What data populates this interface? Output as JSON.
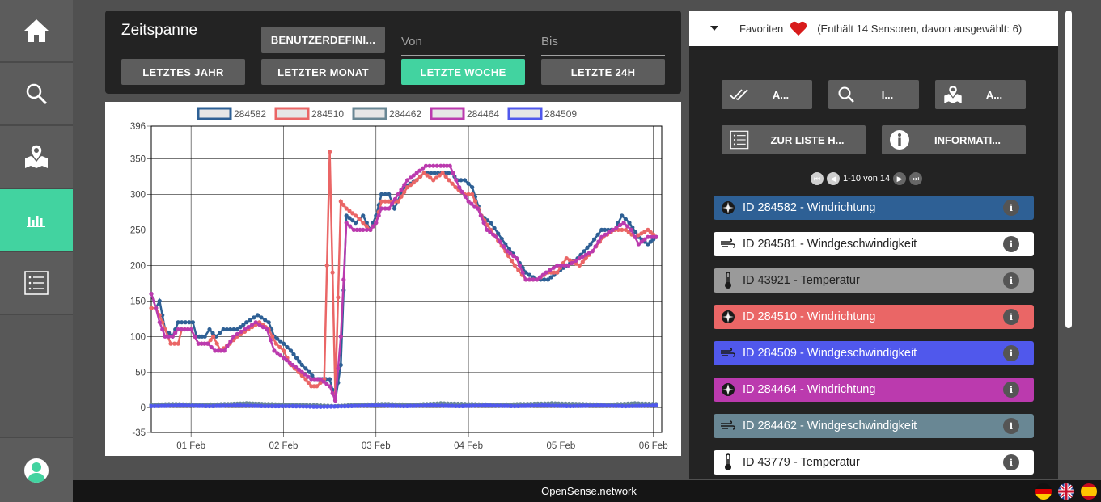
{
  "timespan": {
    "title": "Zeitspanne",
    "custom_label": "BENUTZERDEFINI...",
    "from_label": "Von",
    "to_label": "Bis",
    "buttons": [
      "LETZTES JAHR",
      "LETZTER MONAT",
      "LETZTE WOCHE",
      "LETZTE 24H"
    ],
    "active": "LETZTE WOCHE"
  },
  "favorites": {
    "label": "Favoriten",
    "info": "(Enthält 14 Sensoren, davon ausgewählt: 6)"
  },
  "actions": {
    "a1": "A...",
    "a2": "I...",
    "a3": "A...",
    "list": "ZUR LISTE H...",
    "info": "INFORMATI..."
  },
  "pager": {
    "text": "1-10 von 14"
  },
  "sensors": [
    {
      "label": "ID 284582 - Windrichtung",
      "color": "#2e6095",
      "text_color": "#ffffff",
      "icon": "wind-direction-icon"
    },
    {
      "label": "ID 284581 - Windgeschwindigkeit",
      "color": "#ffffff",
      "text_color": "#222222",
      "icon": "wind-speed-icon"
    },
    {
      "label": "ID 43921 - Temperatur",
      "color": "#9a9a9a",
      "text_color": "#222222",
      "icon": "thermometer-icon"
    },
    {
      "label": "ID 284510 - Windrichtung",
      "color": "#ea6666",
      "text_color": "#ffffff",
      "icon": "wind-direction-icon"
    },
    {
      "label": "ID 284509 - Windgeschwindigkeit",
      "color": "#5058ec",
      "text_color": "#ffffff",
      "icon": "wind-speed-icon"
    },
    {
      "label": "ID 284464 - Windrichtung",
      "color": "#bb3aae",
      "text_color": "#ffffff",
      "icon": "wind-direction-icon"
    },
    {
      "label": "ID 284462 - Windgeschwindigkeit",
      "color": "#698794",
      "text_color": "#ffffff",
      "icon": "wind-speed-icon"
    },
    {
      "label": "ID 43779 - Temperatur",
      "color": "#ffffff",
      "text_color": "#222222",
      "icon": "thermometer-icon"
    }
  ],
  "footer": {
    "brand": "OpenSense.network"
  },
  "chart_data": {
    "type": "line",
    "x_tick_labels": [
      "01 Feb",
      "02 Feb",
      "03 Feb",
      "04 Feb",
      "05 Feb",
      "06 Feb"
    ],
    "y_tick_labels": [
      "-35",
      "0",
      "50",
      "100",
      "150",
      "200",
      "250",
      "300",
      "350",
      "396"
    ],
    "ylim": [
      -35,
      396
    ],
    "xlim": [
      0.57,
      6.09
    ],
    "grid": true,
    "legend_position": "top",
    "series": [
      {
        "name": "284582",
        "color": "#2e6095",
        "points": [
          [
            0.57,
            160
          ],
          [
            0.62,
            140
          ],
          [
            0.66,
            150
          ],
          [
            0.72,
            110
          ],
          [
            0.8,
            100
          ],
          [
            0.86,
            120
          ],
          [
            1.02,
            120
          ],
          [
            1.06,
            100
          ],
          [
            1.15,
            100
          ],
          [
            1.2,
            110
          ],
          [
            1.27,
            100
          ],
          [
            1.35,
            110
          ],
          [
            1.5,
            110
          ],
          [
            1.6,
            120
          ],
          [
            1.72,
            130
          ],
          [
            1.84,
            120
          ],
          [
            1.9,
            100
          ],
          [
            2.0,
            90
          ],
          [
            2.08,
            80
          ],
          [
            2.14,
            70
          ],
          [
            2.2,
            60
          ],
          [
            2.28,
            50
          ],
          [
            2.34,
            40
          ],
          [
            2.5,
            40
          ],
          [
            2.56,
            10
          ],
          [
            2.62,
            60
          ],
          [
            2.68,
            270
          ],
          [
            2.78,
            260
          ],
          [
            2.86,
            270
          ],
          [
            2.94,
            250
          ],
          [
            3.0,
            270
          ],
          [
            3.06,
            300
          ],
          [
            3.14,
            300
          ],
          [
            3.2,
            280
          ],
          [
            3.3,
            310
          ],
          [
            3.44,
            320
          ],
          [
            3.52,
            330
          ],
          [
            3.82,
            330
          ],
          [
            3.88,
            320
          ],
          [
            3.96,
            320
          ],
          [
            4.04,
            310
          ],
          [
            4.14,
            270
          ],
          [
            4.24,
            260
          ],
          [
            4.4,
            230
          ],
          [
            4.52,
            210
          ],
          [
            4.62,
            190
          ],
          [
            4.74,
            180
          ],
          [
            4.86,
            180
          ],
          [
            4.96,
            190
          ],
          [
            5.06,
            200
          ],
          [
            5.18,
            210
          ],
          [
            5.32,
            230
          ],
          [
            5.44,
            250
          ],
          [
            5.58,
            250
          ],
          [
            5.66,
            270
          ],
          [
            5.74,
            260
          ],
          [
            5.84,
            240
          ],
          [
            5.94,
            230
          ],
          [
            6.03,
            240
          ]
        ]
      },
      {
        "name": "284510",
        "color": "#ea6666",
        "points": [
          [
            0.57,
            140
          ],
          [
            0.62,
            140
          ],
          [
            0.66,
            130
          ],
          [
            0.72,
            110
          ],
          [
            0.78,
            90
          ],
          [
            0.86,
            90
          ],
          [
            0.9,
            110
          ],
          [
            1.0,
            110
          ],
          [
            1.08,
            90
          ],
          [
            1.18,
            90
          ],
          [
            1.24,
            100
          ],
          [
            1.32,
            80
          ],
          [
            1.42,
            90
          ],
          [
            1.5,
            100
          ],
          [
            1.62,
            110
          ],
          [
            1.74,
            120
          ],
          [
            1.84,
            110
          ],
          [
            1.92,
            90
          ],
          [
            2.0,
            80
          ],
          [
            2.08,
            60
          ],
          [
            2.16,
            50
          ],
          [
            2.24,
            40
          ],
          [
            2.3,
            30
          ],
          [
            2.36,
            30
          ],
          [
            2.44,
            40
          ],
          [
            2.5,
            360
          ],
          [
            2.56,
            20
          ],
          [
            2.62,
            290
          ],
          [
            2.68,
            280
          ],
          [
            2.78,
            270
          ],
          [
            2.86,
            260
          ],
          [
            2.94,
            250
          ],
          [
            3.0,
            260
          ],
          [
            3.06,
            290
          ],
          [
            3.14,
            290
          ],
          [
            3.24,
            290
          ],
          [
            3.34,
            310
          ],
          [
            3.44,
            320
          ],
          [
            3.52,
            330
          ],
          [
            3.62,
            320
          ],
          [
            3.72,
            330
          ],
          [
            3.86,
            310
          ],
          [
            3.96,
            300
          ],
          [
            4.04,
            300
          ],
          [
            4.14,
            270
          ],
          [
            4.24,
            250
          ],
          [
            4.4,
            220
          ],
          [
            4.5,
            200
          ],
          [
            4.62,
            180
          ],
          [
            4.74,
            180
          ],
          [
            4.86,
            190
          ],
          [
            4.96,
            190
          ],
          [
            5.06,
            210
          ],
          [
            5.2,
            200
          ],
          [
            5.34,
            220
          ],
          [
            5.46,
            240
          ],
          [
            5.58,
            250
          ],
          [
            5.7,
            250
          ],
          [
            5.8,
            240
          ],
          [
            5.94,
            250
          ],
          [
            6.03,
            240
          ]
        ]
      },
      {
        "name": "284462",
        "color": "#698794",
        "points": [
          [
            0.57,
            4
          ],
          [
            0.8,
            5
          ],
          [
            1.1,
            4
          ],
          [
            1.4,
            5
          ],
          [
            1.6,
            6
          ],
          [
            1.8,
            5
          ],
          [
            2.1,
            4
          ],
          [
            2.4,
            3
          ],
          [
            2.56,
            2
          ],
          [
            2.8,
            4
          ],
          [
            3.1,
            5
          ],
          [
            3.4,
            4
          ],
          [
            3.7,
            6
          ],
          [
            4.0,
            5
          ],
          [
            4.3,
            4
          ],
          [
            4.6,
            5
          ],
          [
            4.9,
            6
          ],
          [
            5.2,
            5
          ],
          [
            5.5,
            4
          ],
          [
            5.8,
            6
          ],
          [
            6.03,
            5
          ]
        ]
      },
      {
        "name": "284464",
        "color": "#bb3aae",
        "points": [
          [
            0.57,
            160
          ],
          [
            0.62,
            140
          ],
          [
            0.66,
            120
          ],
          [
            0.72,
            100
          ],
          [
            0.8,
            100
          ],
          [
            0.86,
            110
          ],
          [
            1.0,
            110
          ],
          [
            1.08,
            90
          ],
          [
            1.18,
            90
          ],
          [
            1.26,
            80
          ],
          [
            1.36,
            80
          ],
          [
            1.46,
            100
          ],
          [
            1.58,
            110
          ],
          [
            1.7,
            120
          ],
          [
            1.82,
            110
          ],
          [
            1.9,
            80
          ],
          [
            2.0,
            70
          ],
          [
            2.1,
            60
          ],
          [
            2.2,
            50
          ],
          [
            2.3,
            40
          ],
          [
            2.4,
            40
          ],
          [
            2.5,
            30
          ],
          [
            2.56,
            10
          ],
          [
            2.62,
            100
          ],
          [
            2.68,
            260
          ],
          [
            2.76,
            250
          ],
          [
            2.86,
            250
          ],
          [
            2.94,
            250
          ],
          [
            3.0,
            260
          ],
          [
            3.06,
            280
          ],
          [
            3.14,
            280
          ],
          [
            3.24,
            300
          ],
          [
            3.34,
            320
          ],
          [
            3.44,
            330
          ],
          [
            3.54,
            340
          ],
          [
            3.7,
            340
          ],
          [
            3.8,
            340
          ],
          [
            3.9,
            310
          ],
          [
            4.0,
            290
          ],
          [
            4.1,
            280
          ],
          [
            4.2,
            250
          ],
          [
            4.3,
            240
          ],
          [
            4.42,
            220
          ],
          [
            4.52,
            210
          ],
          [
            4.62,
            180
          ],
          [
            4.74,
            180
          ],
          [
            4.84,
            190
          ],
          [
            4.96,
            200
          ],
          [
            5.08,
            200
          ],
          [
            5.2,
            210
          ],
          [
            5.34,
            220
          ],
          [
            5.44,
            240
          ],
          [
            5.56,
            250
          ],
          [
            5.68,
            260
          ],
          [
            5.76,
            250
          ],
          [
            5.84,
            230
          ],
          [
            5.94,
            240
          ],
          [
            6.03,
            240
          ]
        ]
      },
      {
        "name": "284509",
        "color": "#5058ec",
        "points": [
          [
            0.57,
            2
          ],
          [
            0.9,
            3
          ],
          [
            1.2,
            2
          ],
          [
            1.5,
            3
          ],
          [
            1.8,
            2
          ],
          [
            2.1,
            2
          ],
          [
            2.4,
            1
          ],
          [
            2.7,
            2
          ],
          [
            3.0,
            3
          ],
          [
            3.3,
            2
          ],
          [
            3.6,
            3
          ],
          [
            3.9,
            2
          ],
          [
            4.2,
            3
          ],
          [
            4.5,
            2
          ],
          [
            4.8,
            3
          ],
          [
            5.1,
            2
          ],
          [
            5.4,
            3
          ],
          [
            5.7,
            2
          ],
          [
            6.03,
            3
          ]
        ]
      }
    ]
  }
}
